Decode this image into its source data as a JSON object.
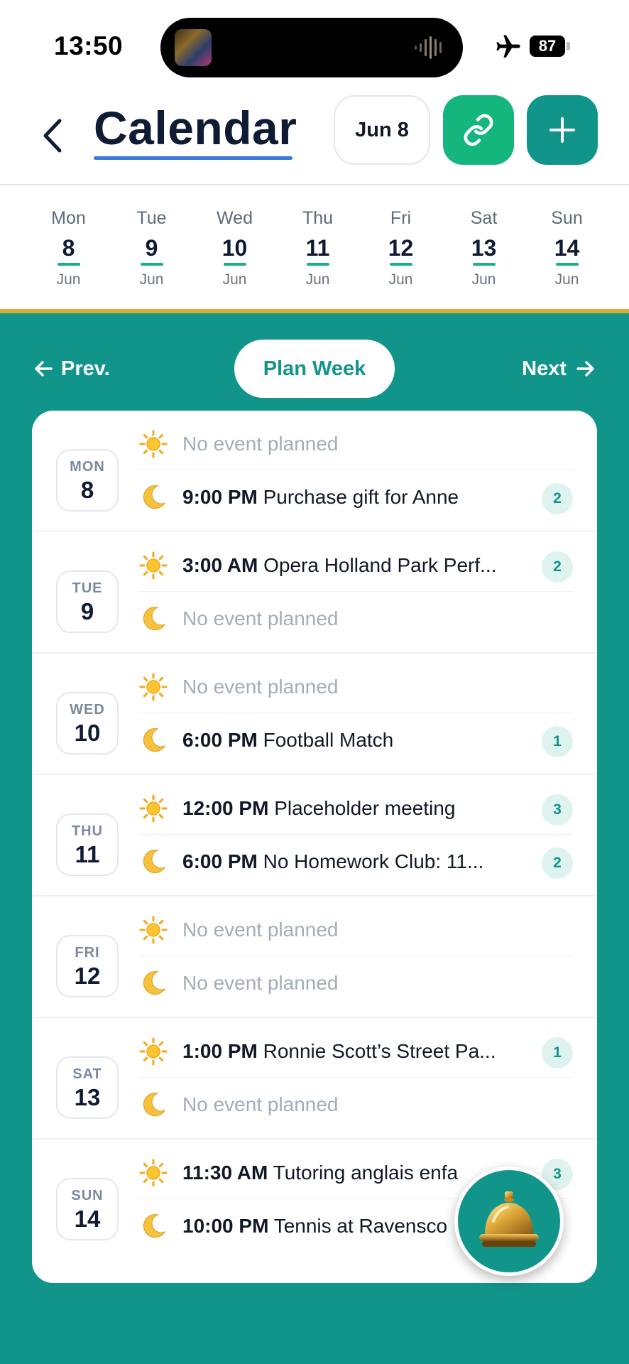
{
  "status_bar": {
    "time": "13:50",
    "battery": "87"
  },
  "header": {
    "title": "Calendar",
    "date_button": "Jun 8"
  },
  "week_strip": [
    {
      "dow": "Mon",
      "day": "8",
      "month": "Jun"
    },
    {
      "dow": "Tue",
      "day": "9",
      "month": "Jun"
    },
    {
      "dow": "Wed",
      "day": "10",
      "month": "Jun"
    },
    {
      "dow": "Thu",
      "day": "11",
      "month": "Jun"
    },
    {
      "dow": "Fri",
      "day": "12",
      "month": "Jun"
    },
    {
      "dow": "Sat",
      "day": "13",
      "month": "Jun"
    },
    {
      "dow": "Sun",
      "day": "14",
      "month": "Jun"
    }
  ],
  "nav": {
    "prev": "Prev.",
    "plan": "Plan Week",
    "next": "Next"
  },
  "days": [
    {
      "abbr": "MON",
      "num": "8",
      "am": {
        "time": "",
        "title": "",
        "empty": "No event planned",
        "count": ""
      },
      "pm": {
        "time": "9:00 PM",
        "title": "Purchase gift for Anne",
        "empty": "",
        "count": "2"
      }
    },
    {
      "abbr": "TUE",
      "num": "9",
      "am": {
        "time": "3:00 AM",
        "title": "Opera Holland Park Perf...",
        "empty": "",
        "count": "2"
      },
      "pm": {
        "time": "",
        "title": "",
        "empty": "No event planned",
        "count": ""
      }
    },
    {
      "abbr": "WED",
      "num": "10",
      "am": {
        "time": "",
        "title": "",
        "empty": "No event planned",
        "count": ""
      },
      "pm": {
        "time": "6:00 PM",
        "title": "Football Match",
        "empty": "",
        "count": "1"
      }
    },
    {
      "abbr": "THU",
      "num": "11",
      "am": {
        "time": "12:00 PM",
        "title": "Placeholder meeting",
        "empty": "",
        "count": "3"
      },
      "pm": {
        "time": "6:00 PM",
        "title": "No Homework Club: 11...",
        "empty": "",
        "count": "2"
      }
    },
    {
      "abbr": "FRI",
      "num": "12",
      "am": {
        "time": "",
        "title": "",
        "empty": "No event planned",
        "count": ""
      },
      "pm": {
        "time": "",
        "title": "",
        "empty": "No event planned",
        "count": ""
      }
    },
    {
      "abbr": "SAT",
      "num": "13",
      "am": {
        "time": "1:00 PM",
        "title": "Ronnie Scott’s Street Pa...",
        "empty": "",
        "count": "1"
      },
      "pm": {
        "time": "",
        "title": "",
        "empty": "No event planned",
        "count": ""
      }
    },
    {
      "abbr": "SUN",
      "num": "14",
      "am": {
        "time": "11:30 AM",
        "title": "Tutoring anglais enfa",
        "empty": "",
        "count": "3"
      },
      "pm": {
        "time": "10:00 PM",
        "title": "Tennis at Ravensco",
        "empty": "",
        "count": ""
      }
    }
  ],
  "icons": {
    "back": "chevron-left-icon",
    "link": "link-icon",
    "add": "plus-icon",
    "morning": "sun-icon",
    "evening": "moon-icon",
    "fab": "service-bell-icon"
  },
  "colors": {
    "teal": "#11958a",
    "green": "#15b67e",
    "gold": "#d9ad3a",
    "navy": "#0f1b34"
  }
}
